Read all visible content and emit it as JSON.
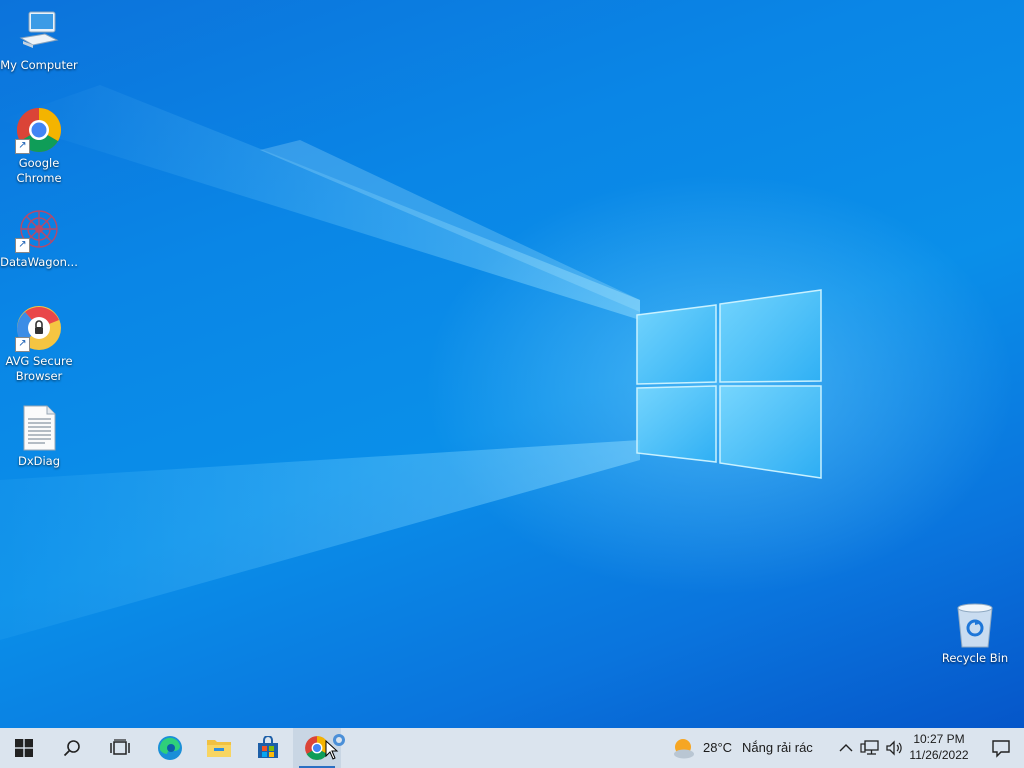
{
  "desktop": {
    "icons": [
      {
        "label": "My Computer",
        "icon": "computer-icon"
      },
      {
        "label": "Google Chrome",
        "icon": "chrome-icon"
      },
      {
        "label": "DataWagon...",
        "icon": "datawagon-icon"
      },
      {
        "label": "AVG Secure Browser",
        "icon": "avg-browser-icon"
      },
      {
        "label": "DxDiag",
        "icon": "text-file-icon"
      },
      {
        "label": "Recycle Bin",
        "icon": "recycle-bin-icon"
      }
    ]
  },
  "taskbar": {
    "buttons": [
      {
        "name": "start",
        "icon": "windows-start-icon"
      },
      {
        "name": "search",
        "icon": "search-icon"
      },
      {
        "name": "task-view",
        "icon": "task-view-icon"
      },
      {
        "name": "edge",
        "icon": "edge-icon"
      },
      {
        "name": "file-explorer",
        "icon": "folder-icon"
      },
      {
        "name": "store",
        "icon": "store-icon"
      },
      {
        "name": "chrome",
        "icon": "chrome-icon",
        "active": true
      }
    ],
    "weather": {
      "temperature": "28°C",
      "condition": "Nắng rải rác",
      "icon": "sun-cloud-icon"
    },
    "tray": {
      "icons": [
        "chevron-up-icon",
        "network-icon",
        "volume-icon"
      ],
      "time": "10:27 PM",
      "date": "11/26/2022",
      "notification_icon": "notification-icon"
    }
  },
  "colors": {
    "desktop_base": "#0a86e6",
    "taskbar_bg": "#dbe4ee",
    "accent": "#2b6fc2"
  }
}
